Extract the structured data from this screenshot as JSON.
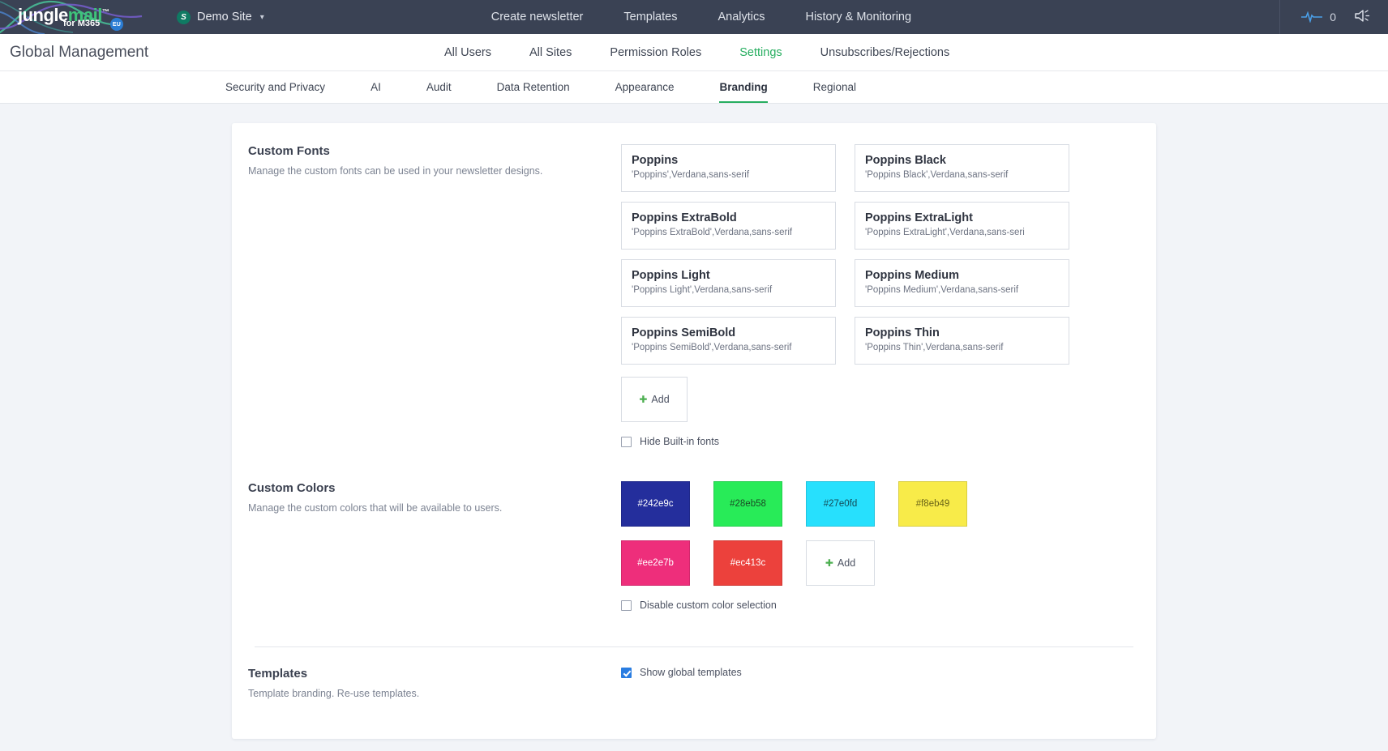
{
  "topbar": {
    "logo": {
      "part1": "jungle",
      "part2": "mail",
      "tm": "™",
      "sub": "for M365",
      "badge": "EU"
    },
    "site_selector": {
      "icon_label": "S",
      "name": "Demo Site",
      "caret": "⌵"
    },
    "nav": [
      {
        "label": "Create newsletter"
      },
      {
        "label": "Templates"
      },
      {
        "label": "Analytics"
      },
      {
        "label": "History & Monitoring"
      }
    ],
    "pulse_count": "0",
    "icons": {
      "pulse": "activity-icon",
      "megaphone": "megaphone-icon"
    }
  },
  "header": {
    "title": "Global Management",
    "nav": [
      {
        "label": "All Users",
        "active": false
      },
      {
        "label": "All Sites",
        "active": false
      },
      {
        "label": "Permission Roles",
        "active": false
      },
      {
        "label": "Settings",
        "active": true
      },
      {
        "label": "Unsubscribes/Rejections",
        "active": false
      }
    ]
  },
  "tabs": [
    {
      "label": "Security and Privacy",
      "active": false
    },
    {
      "label": "AI",
      "active": false
    },
    {
      "label": "Audit",
      "active": false
    },
    {
      "label": "Data Retention",
      "active": false
    },
    {
      "label": "Appearance",
      "active": false
    },
    {
      "label": "Branding",
      "active": true
    },
    {
      "label": "Regional",
      "active": false
    }
  ],
  "fonts_section": {
    "title": "Custom Fonts",
    "description": "Manage the custom fonts can be used in your newsletter designs.",
    "items": [
      {
        "name": "Poppins",
        "stack": "'Poppins',Verdana,sans-serif"
      },
      {
        "name": "Poppins Black",
        "stack": "'Poppins Black',Verdana,sans-serif"
      },
      {
        "name": "Poppins ExtraBold",
        "stack": "'Poppins ExtraBold',Verdana,sans-serif"
      },
      {
        "name": "Poppins ExtraLight",
        "stack": "'Poppins ExtraLight',Verdana,sans-seri"
      },
      {
        "name": "Poppins Light",
        "stack": "'Poppins Light',Verdana,sans-serif"
      },
      {
        "name": "Poppins Medium",
        "stack": "'Poppins Medium',Verdana,sans-serif"
      },
      {
        "name": "Poppins SemiBold",
        "stack": "'Poppins SemiBold',Verdana,sans-serif"
      },
      {
        "name": "Poppins Thin",
        "stack": "'Poppins Thin',Verdana,sans-serif"
      }
    ],
    "add_label": "Add",
    "add_plus": "✚",
    "checkbox": {
      "label": "Hide Built-in fonts",
      "checked": false
    }
  },
  "colors_section": {
    "title": "Custom Colors",
    "description": "Manage the custom colors that will be available to users.",
    "items": [
      {
        "hex": "#242e9c",
        "text_color": "#ffffff"
      },
      {
        "hex": "#28eb58",
        "text_color": "#1a4a25"
      },
      {
        "hex": "#27e0fd",
        "text_color": "#134a56"
      },
      {
        "hex": "#f8eb49",
        "text_color": "#6a6417"
      },
      {
        "hex": "#ee2e7b",
        "text_color": "#ffffff"
      },
      {
        "hex": "#ec413c",
        "text_color": "#ffffff"
      }
    ],
    "add_label": "Add",
    "add_plus": "✚",
    "checkbox": {
      "label": "Disable custom color selection",
      "checked": false
    }
  },
  "templates_section": {
    "title": "Templates",
    "description": "Template branding. Re-use templates.",
    "checkbox": {
      "label": "Show global templates",
      "checked": true
    }
  }
}
